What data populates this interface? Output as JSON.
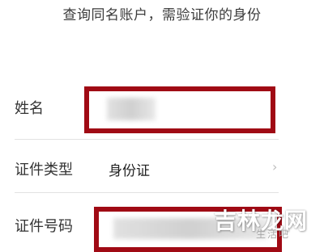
{
  "header": {
    "instruction": "查询同名账户，需验证你的身份"
  },
  "form": {
    "name_label": "姓名",
    "name_value": "",
    "id_type_label": "证件类型",
    "id_type_value": "身份证",
    "id_number_label": "证件号码",
    "id_number_value": ""
  },
  "icons": {
    "id_type_chevron": "chevron-right-icon"
  },
  "colors": {
    "highlight": "#a00a14",
    "divider": "#e2e2e2"
  },
  "watermark": {
    "logo_text": "吉林龙网",
    "sub_text": "生活吧"
  }
}
